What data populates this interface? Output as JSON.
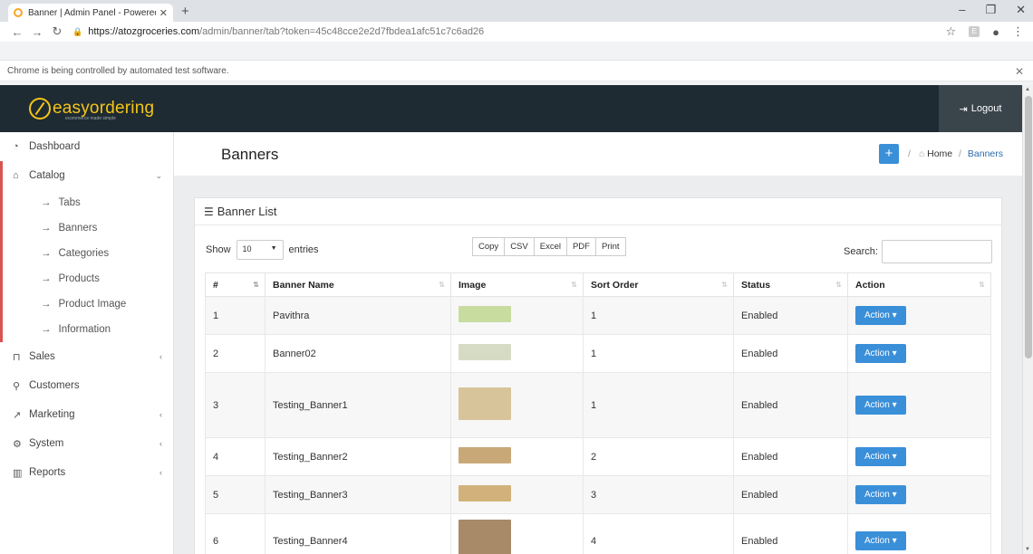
{
  "browser": {
    "tab_title": "Banner | Admin Panel - Powered",
    "url_host": "https://atozgroceries.com",
    "url_path": "/admin/banner/tab?token=45c48cce2e2d7fbdea1afc51c7c6ad26",
    "infobar": "Chrome is being controlled by automated test software."
  },
  "header": {
    "logo_text": "easyordering",
    "logo_tagline": "ecommerce made simple",
    "logout_label": "Logout"
  },
  "sidebar": {
    "items": [
      {
        "label": "Dashboard",
        "icon": "dashboard-icon"
      },
      {
        "label": "Catalog",
        "icon": "tag-icon"
      },
      {
        "label": "Sales",
        "icon": "cart-icon"
      },
      {
        "label": "Customers",
        "icon": "user-icon"
      },
      {
        "label": "Marketing",
        "icon": "share-icon"
      },
      {
        "label": "System",
        "icon": "gear-icon"
      },
      {
        "label": "Reports",
        "icon": "bar-chart-icon"
      }
    ],
    "catalog_sub": [
      "Tabs",
      "Banners",
      "Categories",
      "Products",
      "Product Image",
      "Information"
    ]
  },
  "page": {
    "title": "Banners",
    "breadcrumb": {
      "home": "Home",
      "sep": "/",
      "current": "Banners"
    }
  },
  "panel": {
    "title": "Banner List",
    "show_label": "Show",
    "entries_value": "10",
    "entries_label": "entries",
    "export_buttons": [
      "Copy",
      "CSV",
      "Excel",
      "PDF",
      "Print"
    ],
    "search_label": "Search:"
  },
  "table": {
    "headers": [
      "#",
      "Banner Name",
      "Image",
      "Sort Order",
      "Status",
      "Action"
    ],
    "rows": [
      {
        "num": "1",
        "name": "Pavithra",
        "sort": "1",
        "status": "Enabled",
        "action": "Action",
        "thumb_color": "#c8dca0"
      },
      {
        "num": "2",
        "name": "Banner02",
        "sort": "1",
        "status": "Enabled",
        "action": "Action",
        "thumb_color": "#d6dcc4"
      },
      {
        "num": "3",
        "name": "Testing_Banner1",
        "sort": "1",
        "status": "Enabled",
        "action": "Action",
        "thumb_color": "#d8c49a"
      },
      {
        "num": "4",
        "name": "Testing_Banner2",
        "sort": "2",
        "status": "Enabled",
        "action": "Action",
        "thumb_color": "#c9a878"
      },
      {
        "num": "5",
        "name": "Testing_Banner3",
        "sort": "3",
        "status": "Enabled",
        "action": "Action",
        "thumb_color": "#d2b27a"
      },
      {
        "num": "6",
        "name": "Testing_Banner4",
        "sort": "4",
        "status": "Enabled",
        "action": "Action",
        "thumb_color": "#a88a68"
      }
    ]
  },
  "colors": {
    "accent": "#3a8fd9",
    "header_bg": "#1f2b33",
    "logo": "#f5c518",
    "catalog_marker": "#d9534f"
  }
}
